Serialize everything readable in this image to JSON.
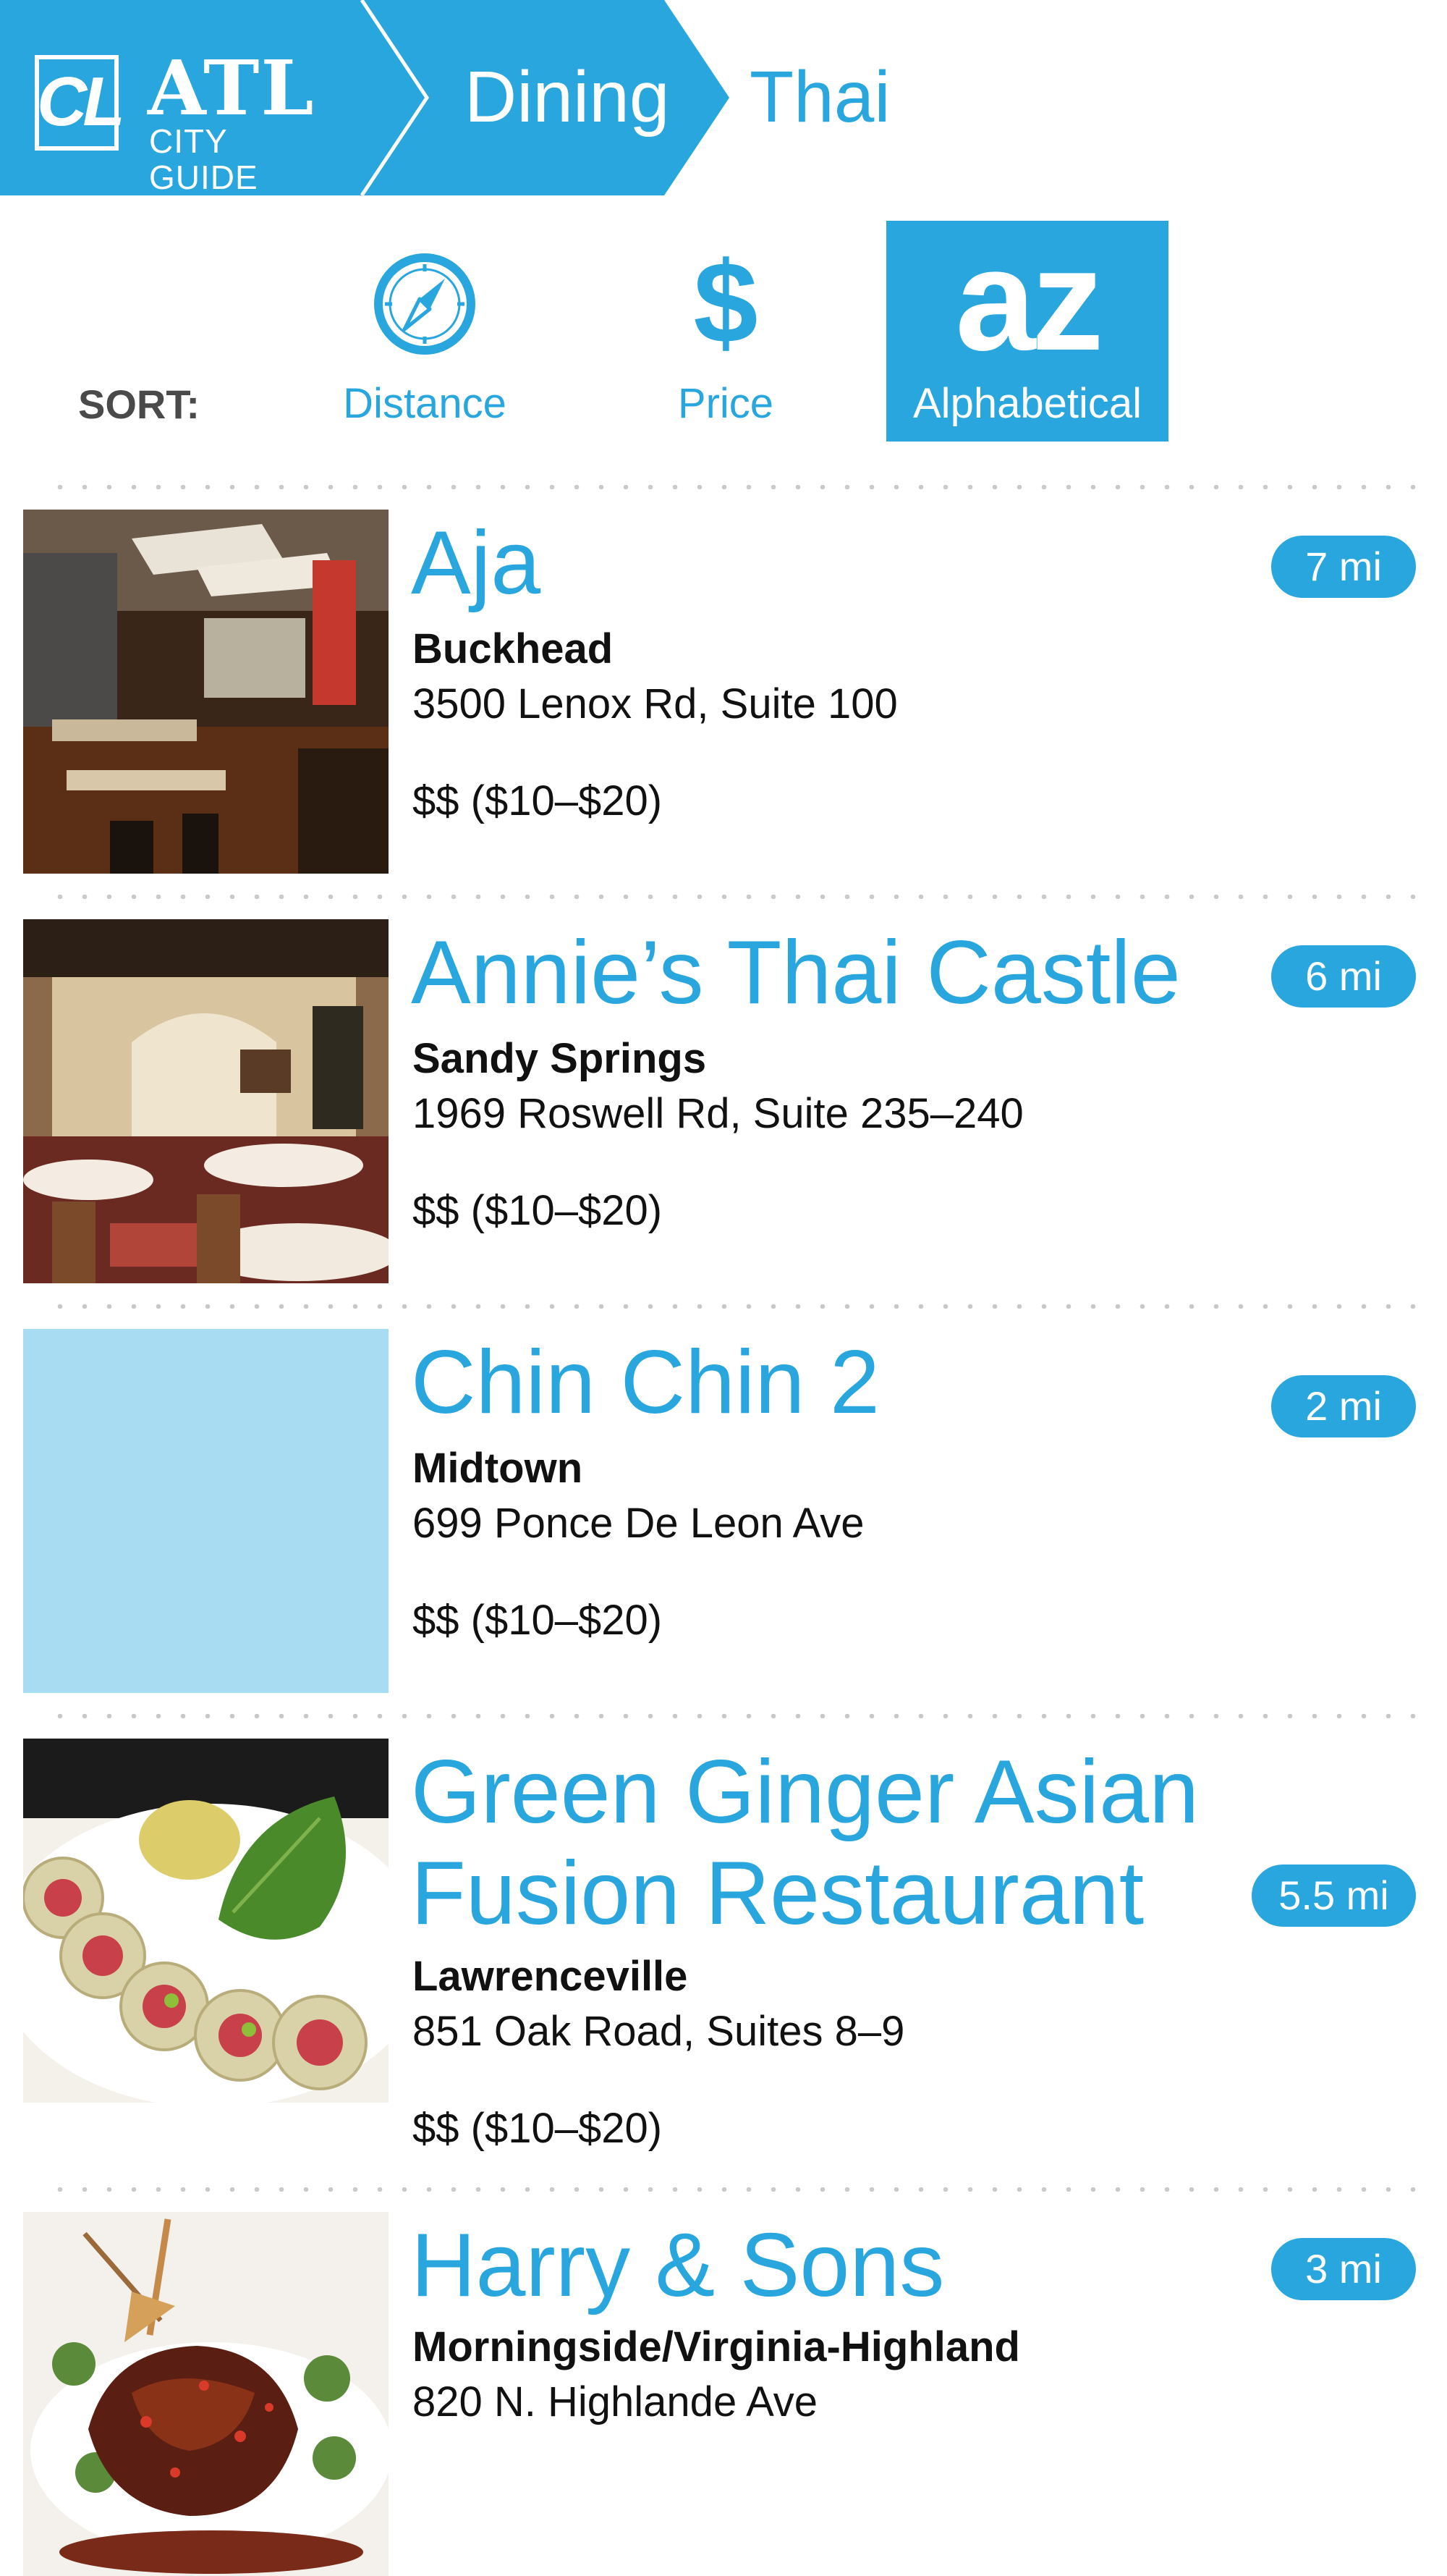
{
  "header": {
    "logo_mark": "CL",
    "logo_title": "ATL",
    "logo_subtitle": "CITY GUIDE",
    "crumb_dining": "Dining",
    "crumb_thai": "Thai",
    "colors": {
      "brand": "#29a6de",
      "placeholder": "#a8dcf3"
    }
  },
  "sort": {
    "label": "SORT:",
    "options": {
      "distance": {
        "label": "Distance",
        "icon": "compass-icon"
      },
      "price": {
        "label": "Price",
        "icon": "$"
      },
      "alphabetical": {
        "label": "Alphabetical",
        "icon": "az",
        "active": true
      }
    }
  },
  "restaurants": [
    {
      "name": "Aja",
      "distance": "7 mi",
      "neighborhood": "Buckhead",
      "address": "3500 Lenox Rd, Suite 100",
      "price": "$$ ($10–$20)"
    },
    {
      "name": "Annie’s Thai Castle",
      "distance": "6 mi",
      "neighborhood": "Sandy Springs",
      "address": "1969 Roswell Rd, Suite 235–240",
      "price": "$$ ($10–$20)"
    },
    {
      "name": "Chin Chin 2",
      "distance": "2 mi",
      "neighborhood": "Midtown",
      "address": "699 Ponce De Leon Ave",
      "price": "$$ ($10–$20)"
    },
    {
      "name_line1": "Green Ginger Asian",
      "name_line2": "Fusion Restaurant",
      "distance": "5.5 mi",
      "neighborhood": "Lawrenceville",
      "address": "851 Oak Road, Suites 8–9",
      "price": "$$ ($10–$20)"
    },
    {
      "name": "Harry & Sons",
      "distance": "3 mi",
      "neighborhood": "Morningside/Virginia-Highland",
      "address": "820 N. Highlande Ave"
    }
  ]
}
